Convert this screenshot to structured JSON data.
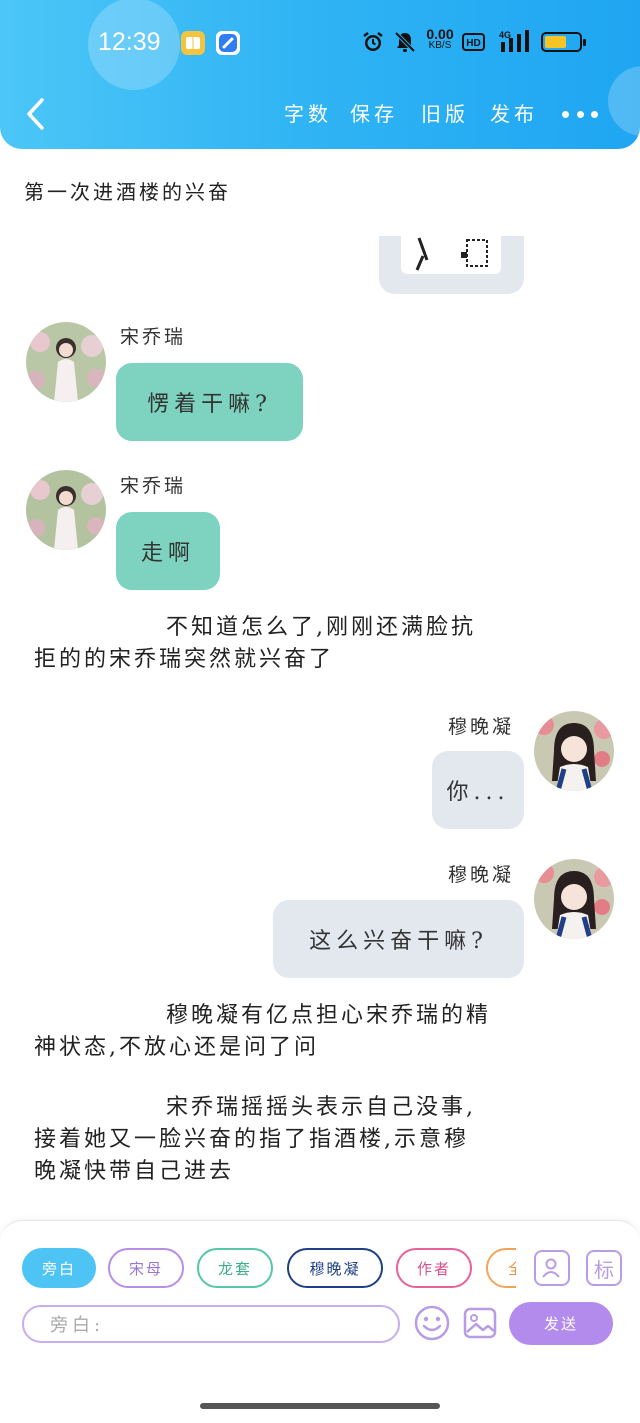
{
  "status_bar": {
    "time": "12:39",
    "net_speed": "0.00",
    "net_unit": "KB/S",
    "hd": "HD",
    "network": "4G",
    "battery_level": 0.65
  },
  "toolbar": {
    "items": [
      "字数",
      "保存",
      "旧版",
      "发布"
    ]
  },
  "chapter_title": "第一次进酒楼的兴奋",
  "messages": [
    {
      "speaker": "宋乔瑞",
      "text": "愣着干嘛?"
    },
    {
      "speaker": "宋乔瑞",
      "text": "走啊"
    },
    {
      "speaker": "穆晚凝",
      "text": "你..."
    },
    {
      "speaker": "穆晚凝",
      "text": "这么兴奋干嘛?"
    }
  ],
  "narrations": [
    {
      "line1": "不知道怎么了,刚刚还满脸抗",
      "line2": "拒的的宋乔瑞突然就兴奋了"
    },
    {
      "line1": "穆晚凝有亿点担心宋乔瑞的精",
      "line2": "神状态,不放心还是问了问"
    },
    {
      "line1": "宋乔瑞摇摇头表示自己没事,",
      "line2": "接着她又一脸兴奋的指了指酒楼,示意穆",
      "line3": "晚凝快带自己进去"
    }
  ],
  "roles": [
    {
      "label": "旁白",
      "color": "#4ec4f5"
    },
    {
      "label": "宋母",
      "color": "#b58ee8"
    },
    {
      "label": "龙套",
      "color": "#55c7a6"
    },
    {
      "label": "穆晚凝",
      "color": "#1f3f86"
    },
    {
      "label": "作者",
      "color": "#e8609c"
    },
    {
      "label": "全",
      "color": "#f4a45a"
    }
  ],
  "mark_button": "标",
  "input": {
    "placeholder": "旁白:"
  },
  "send_button": "发送",
  "colors": {
    "header": "#2fb3f4",
    "left_bubble": "#7dd3bf",
    "right_bubble": "#e3e8ef",
    "send": "#b38bec"
  }
}
